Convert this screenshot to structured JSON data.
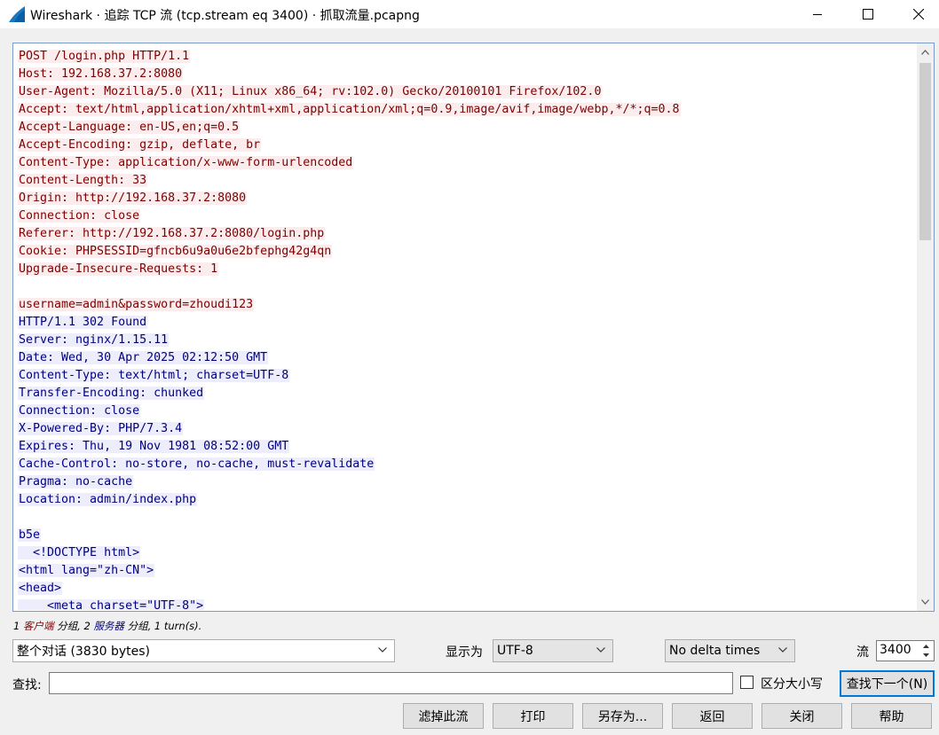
{
  "window": {
    "title": "Wireshark · 追踪 TCP 流 (tcp.stream eq 3400) · 抓取流量.pcapng",
    "icon": "wireshark-fin-icon"
  },
  "stream": {
    "lines": [
      {
        "dir": "client",
        "text": "POST /login.php HTTP/1.1"
      },
      {
        "dir": "client",
        "text": "Host: 192.168.37.2:8080"
      },
      {
        "dir": "client",
        "text": "User-Agent: Mozilla/5.0 (X11; Linux x86_64; rv:102.0) Gecko/20100101 Firefox/102.0"
      },
      {
        "dir": "client",
        "text": "Accept: text/html,application/xhtml+xml,application/xml;q=0.9,image/avif,image/webp,*/*;q=0.8"
      },
      {
        "dir": "client",
        "text": "Accept-Language: en-US,en;q=0.5"
      },
      {
        "dir": "client",
        "text": "Accept-Encoding: gzip, deflate, br"
      },
      {
        "dir": "client",
        "text": "Content-Type: application/x-www-form-urlencoded"
      },
      {
        "dir": "client",
        "text": "Content-Length: 33"
      },
      {
        "dir": "client",
        "text": "Origin: http://192.168.37.2:8080"
      },
      {
        "dir": "client",
        "text": "Connection: close"
      },
      {
        "dir": "client",
        "text": "Referer: http://192.168.37.2:8080/login.php"
      },
      {
        "dir": "client",
        "text": "Cookie: PHPSESSID=gfncb6u9a0u6e2bfephg42g4qn"
      },
      {
        "dir": "client",
        "text": "Upgrade-Insecure-Requests: 1"
      },
      {
        "dir": "client",
        "text": ""
      },
      {
        "dir": "client",
        "text": "username=admin&password=zhoudi123"
      },
      {
        "dir": "server",
        "text": "HTTP/1.1 302 Found"
      },
      {
        "dir": "server",
        "text": "Server: nginx/1.15.11"
      },
      {
        "dir": "server",
        "text": "Date: Wed, 30 Apr 2025 02:12:50 GMT"
      },
      {
        "dir": "server",
        "text": "Content-Type: text/html; charset=UTF-8"
      },
      {
        "dir": "server",
        "text": "Transfer-Encoding: chunked"
      },
      {
        "dir": "server",
        "text": "Connection: close"
      },
      {
        "dir": "server",
        "text": "X-Powered-By: PHP/7.3.4"
      },
      {
        "dir": "server",
        "text": "Expires: Thu, 19 Nov 1981 08:52:00 GMT"
      },
      {
        "dir": "server",
        "text": "Cache-Control: no-store, no-cache, must-revalidate"
      },
      {
        "dir": "server",
        "text": "Pragma: no-cache"
      },
      {
        "dir": "server",
        "text": "Location: admin/index.php"
      },
      {
        "dir": "server",
        "text": ""
      },
      {
        "dir": "server",
        "text": "b5e"
      },
      {
        "dir": "server",
        "text": "  <!DOCTYPE html>"
      },
      {
        "dir": "server",
        "text": "<html lang=\"zh-CN\">"
      },
      {
        "dir": "server",
        "text": "<head>"
      },
      {
        "dir": "server",
        "text": "    <meta charset=\"UTF-8\">"
      }
    ]
  },
  "stats": {
    "client_count": "1",
    "client_label": "客户端",
    "client_suffix": "分组,",
    "server_count": "2",
    "server_label": "服务器",
    "server_suffix": "分组,",
    "turns": "1 turn(s)."
  },
  "controls": {
    "conversation": "整个对话 (3830 bytes)",
    "show_as_label": "显示为",
    "encoding": "UTF-8",
    "delta": "No delta times",
    "stream_label": "流",
    "stream_value": "3400",
    "find_label": "查找:",
    "find_value": "",
    "case_label": "区分大小写",
    "case_checked": false,
    "find_next": "查找下一个(N)"
  },
  "buttons": {
    "filter": "滤掉此流",
    "print": "打印",
    "save_as": "另存为...",
    "back": "返回",
    "close": "关闭",
    "help": "帮助"
  },
  "colors": {
    "client_fg": "#7f0000",
    "client_bg": "#fbeded",
    "server_fg": "#00007f",
    "server_bg": "#ededfb",
    "accent": "#0078d7"
  }
}
